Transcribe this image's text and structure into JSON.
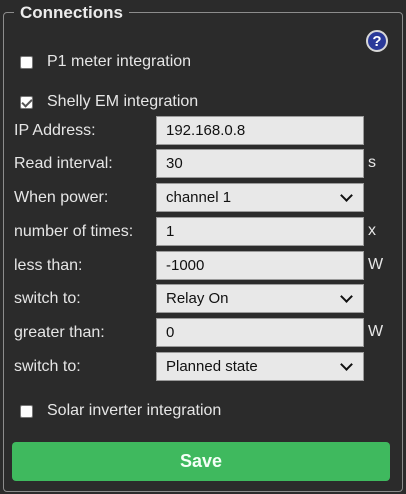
{
  "section": {
    "title": "Connections",
    "help_label": "?"
  },
  "checkboxes": {
    "p1": {
      "label": "P1 meter integration",
      "checked": false
    },
    "shelly": {
      "label": "Shelly EM integration",
      "checked": true
    },
    "solar": {
      "label": "Solar inverter integration",
      "checked": false
    }
  },
  "fields": {
    "ip": {
      "label": "IP Address:",
      "value": "192.168.0.8"
    },
    "interval": {
      "label": "Read interval:",
      "value": "30",
      "unit": "s"
    },
    "when_power": {
      "label": "When power:",
      "value": "channel 1"
    },
    "times": {
      "label": "number of times:",
      "value": "1",
      "unit": "x"
    },
    "less_than": {
      "label": "less than:",
      "value": "-1000",
      "unit": "W"
    },
    "switch1": {
      "label": "switch to:",
      "value": "Relay On"
    },
    "greater_than": {
      "label": "greater than:",
      "value": "0",
      "unit": "W"
    },
    "switch2": {
      "label": "switch to:",
      "value": "Planned state"
    }
  },
  "buttons": {
    "save": "Save"
  },
  "colors": {
    "save_bg": "#3fb95e",
    "help_bg": "#2b3a9a",
    "background": "#2b2b2b"
  },
  "icons": {
    "help": "question-circle-icon",
    "dropdown": "chevron-down-icon",
    "check": "checkmark-icon"
  }
}
